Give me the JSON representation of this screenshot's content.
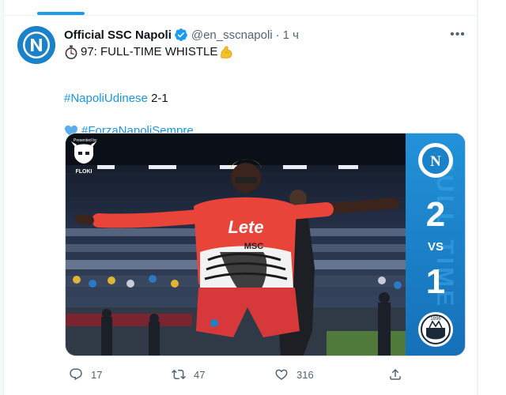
{
  "feed": {
    "tab_indicator_color": "#1d9bf0"
  },
  "tweet": {
    "display_name": "Official SSC Napoli",
    "handle": "@en_sscnapoli",
    "separator": "·",
    "time": "1 ч",
    "more_label": "•••",
    "icons": {
      "avatar": "ssc-napoli-logo",
      "verified": "verified-badge-icon",
      "stopwatch": "stopwatch-emoji",
      "flex": "flexed-biceps-emoji",
      "heart": "blue-heart-emoji"
    },
    "text": {
      "line1": "97: FULL-TIME WHISTLE",
      "line2_hashtag": "#NapoliUdinese",
      "line2_score": " 2-1",
      "line3_hashtag": "#ForzaNapoliSempre"
    },
    "media": {
      "presented_by": "Presented by",
      "sponsor": "FLOKI",
      "jersey_sponsor": "Lete",
      "jersey_text": "MSC",
      "home_score": "2",
      "vs": "VS",
      "away_score": "1",
      "side_text": "FULL TIME",
      "home_crest_letter": "N",
      "away_crest_year": "1896",
      "colors": {
        "napoli_blue": "#1b82c9",
        "kit_red": "#e8443a"
      }
    },
    "actions": {
      "reply_count": "17",
      "retweet_count": "47",
      "like_count": "316"
    }
  }
}
